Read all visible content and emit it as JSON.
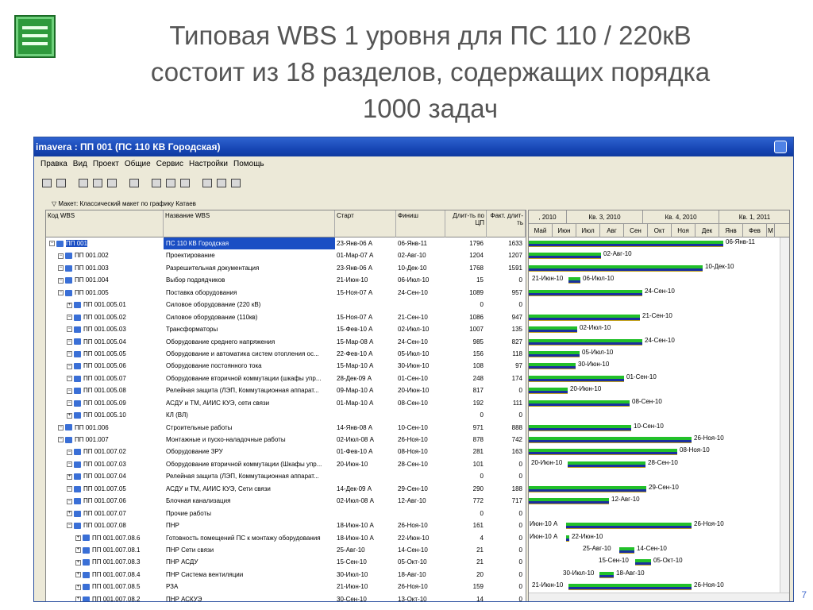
{
  "slide": {
    "title_line1": "Типовая WBS 1 уровня для ПС 110 / 220кВ",
    "title_line2": "состоит из 18 разделов, содержащих порядка",
    "title_line3": "1000 задач",
    "page_number": "7"
  },
  "window": {
    "title": "imavera : ПП 001 (ПС 110 КВ Городская)",
    "menu": [
      "Правка",
      "Вид",
      "Проект",
      "Общие",
      "Сервис",
      "Настройки",
      "Помощь"
    ],
    "layout_label": "Макет: Классический макет по графику Катаев"
  },
  "table": {
    "headers": {
      "code": "Код WBS",
      "name": "Название WBS",
      "start": "Старт",
      "finish": "Финиш",
      "dur": "Длит-ть по ЦП",
      "act": "Факт. длит-ть"
    },
    "rows": [
      {
        "code": "ПП 001",
        "name": "ПС 110 КВ Городская",
        "start": "23-Янв-06 А",
        "finish": "06-Янв-11",
        "dur": "1796",
        "act": "1633",
        "lvl": 0,
        "sel": true
      },
      {
        "code": "ПП 001.002",
        "name": "Проектирование",
        "start": "01-Мар-07 А",
        "finish": "02-Авг-10",
        "dur": "1204",
        "act": "1207",
        "lvl": 1
      },
      {
        "code": "ПП 001.003",
        "name": "Разрешительная документация",
        "start": "23-Янв-06 А",
        "finish": "10-Дек-10",
        "dur": "1768",
        "act": "1591",
        "lvl": 1
      },
      {
        "code": "ПП 001.004",
        "name": "Выбор подрядчиков",
        "start": "21-Июн-10",
        "finish": "06-Июл-10",
        "dur": "15",
        "act": "0",
        "lvl": 1
      },
      {
        "code": "ПП 001.005",
        "name": "Поставка оборудования",
        "start": "15-Ноя-07 А",
        "finish": "24-Сен-10",
        "dur": "1089",
        "act": "957",
        "lvl": 1
      },
      {
        "code": "ПП 001.005.01",
        "name": "Силовое оборудование (220 кВ)",
        "start": "",
        "finish": "",
        "dur": "0",
        "act": "0",
        "lvl": 2
      },
      {
        "code": "ПП 001.005.02",
        "name": "Силовое оборудование (110кв)",
        "start": "15-Ноя-07 А",
        "finish": "21-Сен-10",
        "dur": "1086",
        "act": "947",
        "lvl": 2
      },
      {
        "code": "ПП 001.005.03",
        "name": "Трансформаторы",
        "start": "15-Фев-10 А",
        "finish": "02-Июл-10",
        "dur": "1007",
        "act": "135",
        "lvl": 2
      },
      {
        "code": "ПП 001.005.04",
        "name": "Оборудование среднего напряжения",
        "start": "15-Мар-08 А",
        "finish": "24-Сен-10",
        "dur": "985",
        "act": "827",
        "lvl": 2
      },
      {
        "code": "ПП 001.005.05",
        "name": "Оборудование и автоматика систем отопления ос...",
        "start": "22-Фев-10 А",
        "finish": "05-Июл-10",
        "dur": "156",
        "act": "118",
        "lvl": 2
      },
      {
        "code": "ПП 001.005.06",
        "name": "Оборудование постоянного тока",
        "start": "15-Мар-10 А",
        "finish": "30-Июн-10",
        "dur": "108",
        "act": "97",
        "lvl": 2
      },
      {
        "code": "ПП 001.005.07",
        "name": "Оборудование вторичной коммутации (шкафы упр...",
        "start": "28-Дек-09 А",
        "finish": "01-Сен-10",
        "dur": "248",
        "act": "174",
        "lvl": 2
      },
      {
        "code": "ПП 001.005.08",
        "name": "Релейная защита (ЛЭП, Коммутационная аппарат...",
        "start": "09-Мар-10 А",
        "finish": "20-Июн-10",
        "dur": "817",
        "act": "0",
        "lvl": 2
      },
      {
        "code": "ПП 001.005.09",
        "name": "АСДУ и ТМ, АИИС КУЭ, сети связи",
        "start": "01-Мар-10 А",
        "finish": "08-Сен-10",
        "dur": "192",
        "act": "111",
        "lvl": 2
      },
      {
        "code": "ПП 001.005.10",
        "name": "КЛ (ВЛ)",
        "start": "",
        "finish": "",
        "dur": "0",
        "act": "0",
        "lvl": 2
      },
      {
        "code": "ПП 001.006",
        "name": "Строительные работы",
        "start": "14-Янв-08 А",
        "finish": "10-Сен-10",
        "dur": "971",
        "act": "888",
        "lvl": 1
      },
      {
        "code": "ПП 001.007",
        "name": "Монтажные и пуско-наладочные работы",
        "start": "02-Июл-08 А",
        "finish": "26-Ноя-10",
        "dur": "878",
        "act": "742",
        "lvl": 1
      },
      {
        "code": "ПП 001.007.02",
        "name": "Оборудование ЗРУ",
        "start": "01-Фев-10 А",
        "finish": "08-Ноя-10",
        "dur": "281",
        "act": "163",
        "lvl": 2
      },
      {
        "code": "ПП 001.007.03",
        "name": "Оборудование вторичной коммутации (Шкафы упр...",
        "start": "20-Июн-10",
        "finish": "28-Сен-10",
        "dur": "101",
        "act": "0",
        "lvl": 2
      },
      {
        "code": "ПП 001.007.04",
        "name": "Релейная защита (ЛЭП, Коммутационная аппарат...",
        "start": "",
        "finish": "",
        "dur": "0",
        "act": "0",
        "lvl": 2
      },
      {
        "code": "ПП 001.007.05",
        "name": "АСДУ и ТМ, АИИС КУЭ, Сети связи",
        "start": "14-Дек-09 А",
        "finish": "29-Сен-10",
        "dur": "290",
        "act": "188",
        "lvl": 2
      },
      {
        "code": "ПП 001.007.06",
        "name": "Блочная канализация",
        "start": "02-Июл-08 А",
        "finish": "12-Авг-10",
        "dur": "772",
        "act": "717",
        "lvl": 2
      },
      {
        "code": "ПП 001.007.07",
        "name": "Прочие работы",
        "start": "",
        "finish": "",
        "dur": "0",
        "act": "0",
        "lvl": 2
      },
      {
        "code": "ПП 001.007.08",
        "name": "ПНР",
        "start": "18-Июн-10 А",
        "finish": "26-Ноя-10",
        "dur": "161",
        "act": "0",
        "lvl": 2
      },
      {
        "code": "ПП 001.007.08.6",
        "name": "Готовность помещений ПС к монтажу оборудования",
        "start": "18-Июн-10 А",
        "finish": "22-Июн-10",
        "dur": "4",
        "act": "0",
        "lvl": 3
      },
      {
        "code": "ПП 001.007.08.1",
        "name": "ПНР Сети связи",
        "start": "25-Авг-10",
        "finish": "14-Сен-10",
        "dur": "21",
        "act": "0",
        "lvl": 3
      },
      {
        "code": "ПП 001.007.08.3",
        "name": "ПНР АСДУ",
        "start": "15-Сен-10",
        "finish": "05-Окт-10",
        "dur": "21",
        "act": "0",
        "lvl": 3
      },
      {
        "code": "ПП 001.007.08.4",
        "name": "ПНР Система вентиляции",
        "start": "30-Июл-10",
        "finish": "18-Авг-10",
        "dur": "20",
        "act": "0",
        "lvl": 3
      },
      {
        "code": "ПП 001.007.08.5",
        "name": "РЗА",
        "start": "21-Июн-10",
        "finish": "26-Ноя-10",
        "dur": "159",
        "act": "0",
        "lvl": 3
      },
      {
        "code": "ПП 001.007.08.2",
        "name": "ПНР АСКУЭ",
        "start": "30-Сен-10",
        "finish": "13-Окт-10",
        "dur": "14",
        "act": "0",
        "lvl": 3
      }
    ]
  },
  "gantt": {
    "quarters": [
      ", 2010",
      "Кв. 3, 2010",
      "Кв. 4, 2010",
      "Кв. 1, 2011"
    ],
    "months": [
      "Май",
      "Июн",
      "Июл",
      "Авг",
      "Сен",
      "Окт",
      "Ноя",
      "Дек",
      "Янв",
      "Фев",
      "М"
    ],
    "labels": [
      {
        "r": "06-Янв-11"
      },
      {
        "r": "02-Авг-10"
      },
      {
        "r": "10-Дек-10"
      },
      {
        "l": "21-Июн-10",
        "r": "06-Июл-10"
      },
      {
        "r": "24-Сен-10"
      },
      {},
      {
        "r": "21-Сен-10"
      },
      {
        "r": "02-Июл-10"
      },
      {
        "r": "24-Сен-10"
      },
      {
        "r": "05-Июл-10"
      },
      {
        "r": "30-Июн-10"
      },
      {
        "r": "01-Сен-10"
      },
      {
        "r": "20-Июн-10"
      },
      {
        "r": "08-Сен-10"
      },
      {},
      {
        "r": "10-Сен-10"
      },
      {
        "r": "26-Ноя-10"
      },
      {
        "r": "08-Ноя-10"
      },
      {
        "l": "20-Июн-10",
        "r": "28-Сен-10"
      },
      {},
      {
        "r": "29-Сен-10"
      },
      {
        "r": "12-Авг-10"
      },
      {},
      {
        "l": "Июн-10 А",
        "r": "26-Ноя-10"
      },
      {
        "l": "Июн-10 А",
        "r": "22-Июн-10"
      },
      {
        "l": "25-Авг-10",
        "r": "14-Сен-10"
      },
      {
        "l": "15-Сен-10",
        "r": "05-Окт-10"
      },
      {
        "l": "30-Июл-10",
        "r": "18-Авг-10"
      },
      {
        "l": "21-Июн-10",
        "r": "26-Ноя-10"
      },
      {}
    ]
  }
}
